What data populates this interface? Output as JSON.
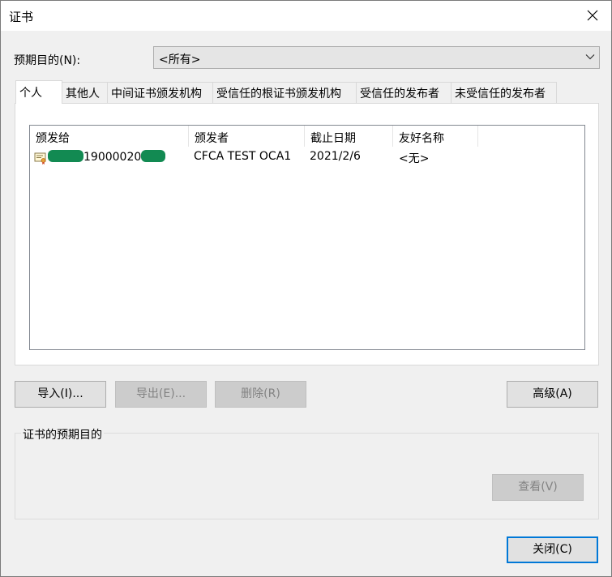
{
  "window": {
    "title": "证书"
  },
  "purpose": {
    "label": "预期目的(N):",
    "value": "<所有>"
  },
  "tabs": [
    {
      "label": "个人"
    },
    {
      "label": "其他人"
    },
    {
      "label": "中间证书颁发机构"
    },
    {
      "label": "受信任的根证书颁发机构"
    },
    {
      "label": "受信任的发布者"
    },
    {
      "label": "未受信任的发布者"
    }
  ],
  "list": {
    "columns": [
      "颁发给",
      "颁发者",
      "截止日期",
      "友好名称"
    ],
    "rows": [
      {
        "issued_to": "19000020",
        "issuer": "CFCA TEST OCA1",
        "expires": "2021/2/6",
        "friendly": "<无>",
        "icon": "certificate-icon"
      }
    ]
  },
  "buttons": {
    "import": "导入(I)...",
    "export": "导出(E)...",
    "remove": "删除(R)",
    "advanced": "高级(A)",
    "view": "查看(V)",
    "close": "关闭(C)"
  },
  "group": {
    "label": "证书的预期目的"
  },
  "colors": {
    "accent": "#0078d7",
    "redaction": "#128a52"
  }
}
